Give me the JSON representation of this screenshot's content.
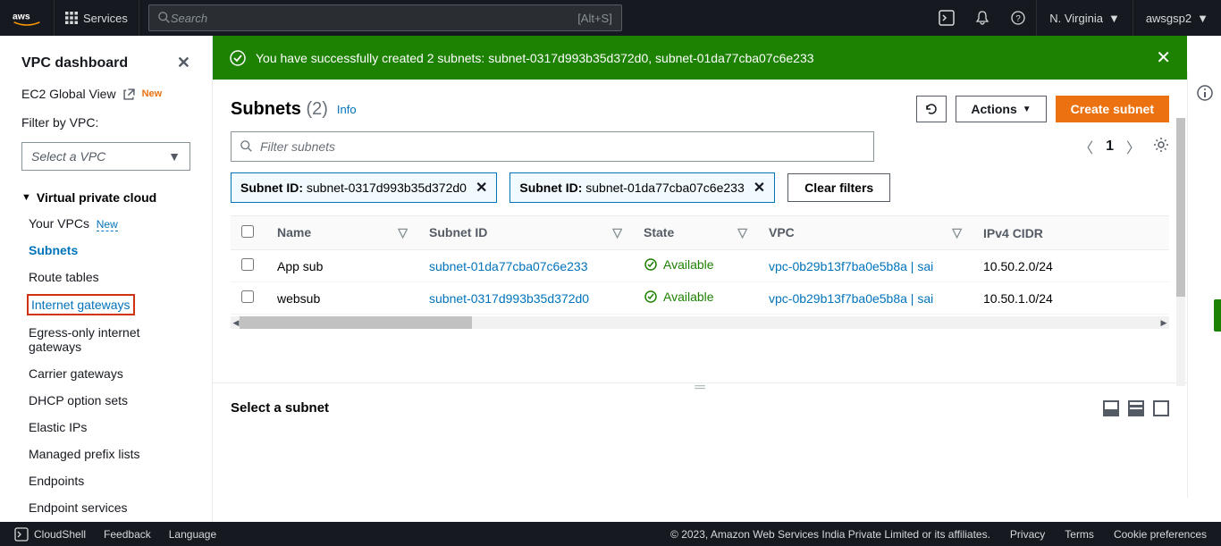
{
  "top": {
    "services": "Services",
    "search_placeholder": "Search",
    "search_kbd": "[Alt+S]",
    "region": "N. Virginia",
    "user": "awsgsp2"
  },
  "sidebar": {
    "dashboard": "VPC dashboard",
    "ec2_global": "EC2 Global View",
    "new_badge": "New",
    "filter_label": "Filter by VPC:",
    "select_vpc_placeholder": "Select a VPC",
    "section": "Virtual private cloud",
    "items": [
      {
        "label": "Your VPCs",
        "new": true
      },
      {
        "label": "Subnets",
        "active": true
      },
      {
        "label": "Route tables"
      },
      {
        "label": "Internet gateways",
        "highlighted": true
      },
      {
        "label": "Egress-only internet gateways"
      },
      {
        "label": "Carrier gateways"
      },
      {
        "label": "DHCP option sets"
      },
      {
        "label": "Elastic IPs"
      },
      {
        "label": "Managed prefix lists"
      },
      {
        "label": "Endpoints"
      },
      {
        "label": "Endpoint services"
      }
    ]
  },
  "banner": {
    "text": "You have successfully created 2 subnets: subnet-0317d993b35d372d0, subnet-01da77cba07c6e233"
  },
  "page": {
    "title": "Subnets",
    "count": "(2)",
    "info": "Info",
    "actions": "Actions",
    "create": "Create subnet",
    "filter_placeholder": "Filter subnets",
    "page_num": "1"
  },
  "chips": [
    {
      "key": "Subnet ID:",
      "val": " subnet-0317d993b35d372d0"
    },
    {
      "key": "Subnet ID:",
      "val": " subnet-01da77cba07c6e233"
    }
  ],
  "clear_filters": "Clear filters",
  "columns": [
    "Name",
    "Subnet ID",
    "State",
    "VPC",
    "IPv4 CIDR"
  ],
  "rows": [
    {
      "name": "App sub",
      "subnet": "subnet-01da77cba07c6e233",
      "state": "Available",
      "vpc": "vpc-0b29b13f7ba0e5b8a | sai",
      "cidr": "10.50.2.0/24"
    },
    {
      "name": "websub",
      "subnet": "subnet-0317d993b35d372d0",
      "state": "Available",
      "vpc": "vpc-0b29b13f7ba0e5b8a | sai",
      "cidr": "10.50.1.0/24"
    }
  ],
  "detail": {
    "title": "Select a subnet"
  },
  "footer": {
    "cloudshell": "CloudShell",
    "feedback": "Feedback",
    "language": "Language",
    "copyright": "© 2023, Amazon Web Services India Private Limited or its affiliates.",
    "privacy": "Privacy",
    "terms": "Terms",
    "cookies": "Cookie preferences"
  }
}
